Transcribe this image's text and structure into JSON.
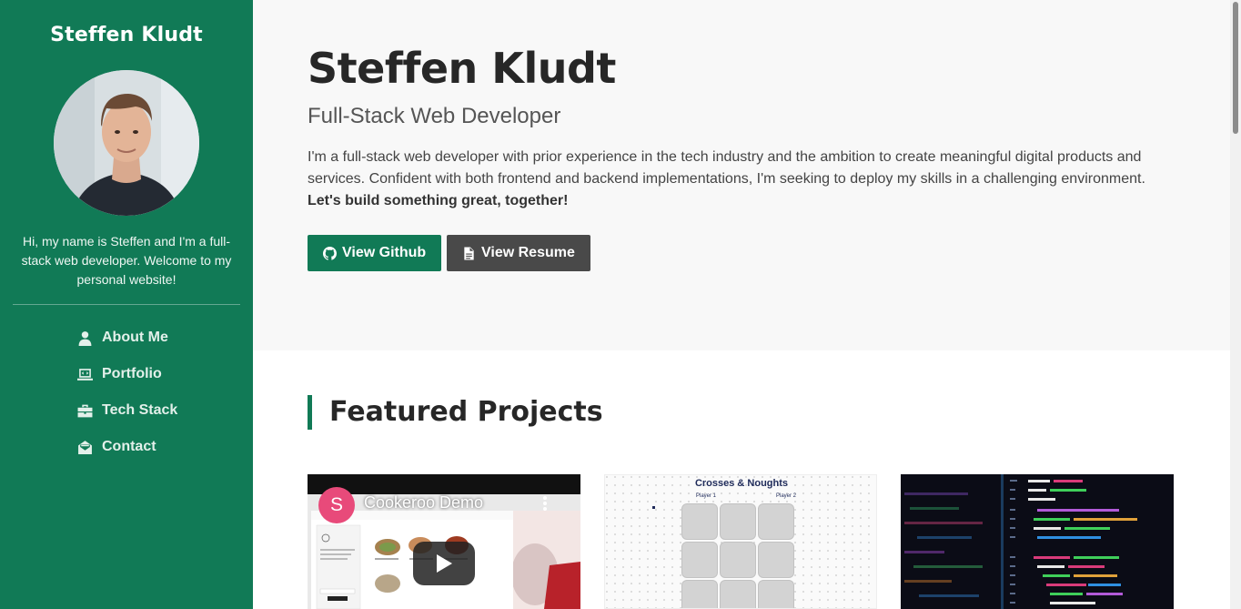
{
  "sidebar": {
    "brand": "Steffen Kludt",
    "bio": "Hi, my name is Steffen and I'm a full-stack web developer. Welcome to my personal website!",
    "nav": [
      {
        "label": "About Me",
        "icon": "user-icon"
      },
      {
        "label": "Portfolio",
        "icon": "laptop-code-icon"
      },
      {
        "label": "Tech Stack",
        "icon": "briefcase-icon"
      },
      {
        "label": "Contact",
        "icon": "envelope-open-icon"
      }
    ],
    "bg_color": "#117a56"
  },
  "hero": {
    "name": "Steffen Kludt",
    "tagline": "Full-Stack Web Developer",
    "intro": "I'm a full-stack web developer with prior experience in the tech industry and the ambition to create meaningful digital products and services. Confident with both frontend and backend implementations, I'm seeking to deploy my skills in a challenging environment.",
    "intro_strong": "Let's build something great, together!",
    "github_label": "View Github",
    "resume_label": "View Resume"
  },
  "projects": {
    "title": "Featured Projects",
    "cards": [
      {
        "video_title": "Cookeroo Demo",
        "channel_initial": "S"
      },
      {
        "game_title": "Crosses & Noughts",
        "player1": "Player 1",
        "player2": "Player 2"
      },
      {}
    ]
  },
  "colors": {
    "accent": "#117a56",
    "dark_button": "#494949",
    "hero_bg": "#f8f8f8"
  }
}
